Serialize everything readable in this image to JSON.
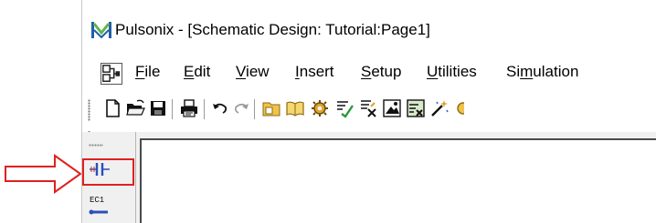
{
  "window": {
    "title": "Pulsonix - [Schematic Design: Tutorial:Page1]",
    "app_icon": "pulsonix-logo-icon"
  },
  "menu": {
    "items": [
      {
        "id": "file",
        "label": "File",
        "underline": "F",
        "rest": "ile"
      },
      {
        "id": "edit",
        "label": "Edit",
        "underline": "E",
        "rest": "dit"
      },
      {
        "id": "view",
        "label": "View",
        "underline": "V",
        "rest": "iew"
      },
      {
        "id": "insert",
        "label": "Insert",
        "underline": "I",
        "rest": "nsert"
      },
      {
        "id": "setup",
        "label": "Setup",
        "underline": "S",
        "rest": "etup"
      },
      {
        "id": "utilities",
        "label": "Utilities",
        "underline": "U",
        "rest": "tilities"
      },
      {
        "id": "simulation",
        "label": "Simulation",
        "prefix": "Si",
        "underline": "m",
        "rest": "ulation"
      }
    ]
  },
  "toolbar": {
    "icons": [
      "new-document-icon",
      "open-folder-icon",
      "save-icon",
      "print-icon",
      "undo-icon",
      "redo-icon",
      "open-library-icon",
      "book-icon",
      "component-gear-icon",
      "design-check-icon",
      "netlist-icon",
      "image-icon",
      "schematic-icon",
      "magic-wand-icon"
    ]
  },
  "side_palette": {
    "capacitor_icon": "capacitor-icon",
    "ec_label": "EC1"
  },
  "annotation": {
    "highlight_color": "#e02020",
    "arrow_color": "#e02020"
  }
}
